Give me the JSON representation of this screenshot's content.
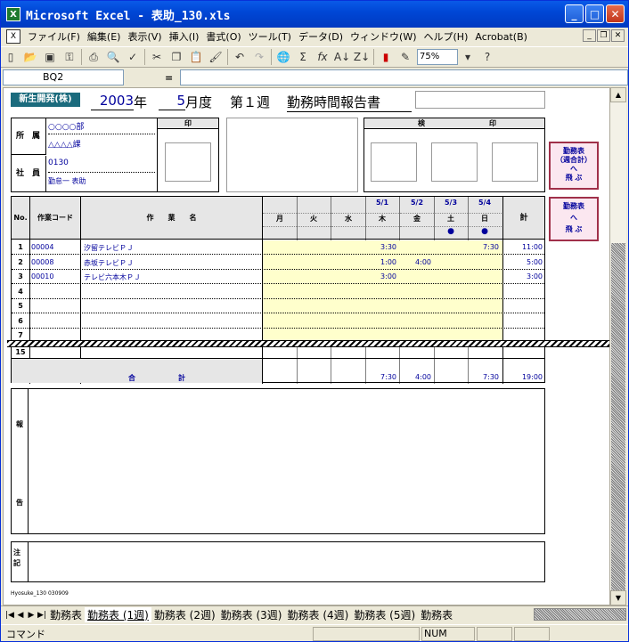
{
  "window": {
    "title": "Microsoft Excel - 表助_130.xls",
    "app_icon": "excel-icon"
  },
  "menu": [
    "ファイル(F)",
    "編集(E)",
    "表示(V)",
    "挿入(I)",
    "書式(O)",
    "ツール(T)",
    "データ(D)",
    "ウィンドウ(W)",
    "ヘルプ(H)",
    "Acrobat(B)"
  ],
  "toolbar": {
    "zoom": "75%",
    "icons": [
      "new-icon",
      "open-icon",
      "save-icon",
      "permission-icon",
      "print-icon",
      "print-preview-icon",
      "spelling-icon",
      "cut-icon",
      "copy-icon",
      "paste-icon",
      "format-painter-icon",
      "undo-icon",
      "redo-icon",
      "hyperlink-icon",
      "autosum-icon",
      "function-icon",
      "sort-asc-icon",
      "sort-desc-icon",
      "chart-wizard-icon",
      "drawing-icon",
      "help-icon"
    ]
  },
  "formula": {
    "cell": "BQ2",
    "equals": "=",
    "value": ""
  },
  "report": {
    "company": "新生開発(株)",
    "year": "2003",
    "year_label": "年",
    "month": "5",
    "month_label": "月度",
    "week": "第１週",
    "title": "勤務時間報告書",
    "dept_label": "所　属",
    "dept1": "○○○○部",
    "dept2": "△△△△課",
    "emp_label": "社　員",
    "emp_no": "0130",
    "emp_name": "勤怠一 表助",
    "seal_label": "印",
    "inspect_label": "検",
    "inspect_seal": "印",
    "btn_weekly_total": "勤務表\n（週合計）\n へ\n飛 ぶ",
    "btn_sheet": "勤務表\nへ\n飛 ぶ",
    "col_no": "No.",
    "col_code": "作業コード",
    "col_name": "作　　業　　名",
    "col_total": "計",
    "days": [
      {
        "date": "",
        "dow": "月",
        "mark": ""
      },
      {
        "date": "",
        "dow": "火",
        "mark": ""
      },
      {
        "date": "",
        "dow": "水",
        "mark": ""
      },
      {
        "date": "5/1",
        "dow": "木",
        "mark": ""
      },
      {
        "date": "5/2",
        "dow": "金",
        "mark": ""
      },
      {
        "date": "5/3",
        "dow": "土",
        "mark": "●"
      },
      {
        "date": "5/4",
        "dow": "日",
        "mark": "●"
      }
    ],
    "rows": [
      {
        "no": "1",
        "code": "00004",
        "name": "汐留テレビＰＪ",
        "vals": [
          "",
          "",
          "",
          "3:30",
          "",
          "",
          "7:30"
        ],
        "total": "11:00"
      },
      {
        "no": "2",
        "code": "00008",
        "name": "赤坂テレビＰＪ",
        "vals": [
          "",
          "",
          "",
          "1:00",
          "4:00",
          "",
          ""
        ],
        "total": "5:00"
      },
      {
        "no": "3",
        "code": "00010",
        "name": "テレビ六本木ＰＪ",
        "vals": [
          "",
          "",
          "",
          "3:00",
          "",
          "",
          ""
        ],
        "total": "3:00"
      },
      {
        "no": "4",
        "code": "",
        "name": "",
        "vals": [
          "",
          "",
          "",
          "",
          "",
          "",
          ""
        ],
        "total": ""
      },
      {
        "no": "5",
        "code": "",
        "name": "",
        "vals": [
          "",
          "",
          "",
          "",
          "",
          "",
          ""
        ],
        "total": ""
      },
      {
        "no": "6",
        "code": "",
        "name": "",
        "vals": [
          "",
          "",
          "",
          "",
          "",
          "",
          ""
        ],
        "total": ""
      },
      {
        "no": "7",
        "code": "",
        "name": "",
        "vals": [
          "",
          "",
          "",
          "",
          "",
          "",
          ""
        ],
        "total": ""
      }
    ],
    "last_row_no": "15",
    "sum_label": "合　　　　　　計",
    "sum_vals": [
      "",
      "",
      "",
      "7:30",
      "4:00",
      "",
      "7:30"
    ],
    "sum_total": "19:00",
    "report_label_top": "報",
    "report_label_bottom": "告",
    "note_label": "注記",
    "footer": "Hyosuke_130  030909"
  },
  "tabs": [
    "勤務表",
    "勤務表 (1週)",
    "勤務表 (2週)",
    "勤務表 (3週)",
    "勤務表 (4週)",
    "勤務表 (5週)",
    "勤務表"
  ],
  "status": {
    "text": "コマンド",
    "num": "NUM"
  }
}
